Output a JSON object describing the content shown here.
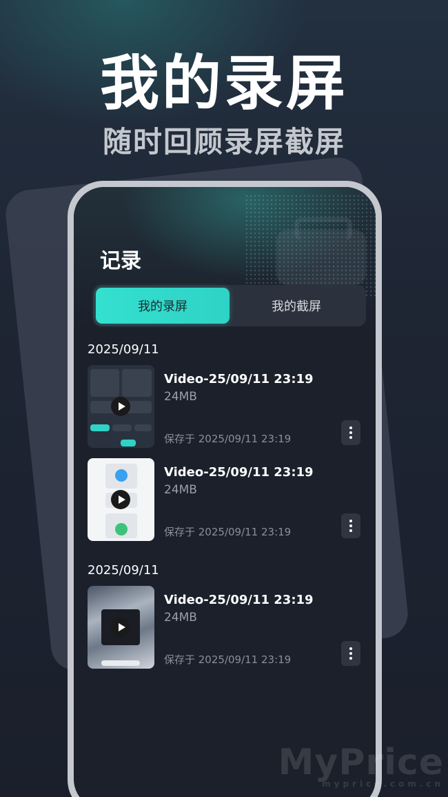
{
  "hero": {
    "title": "我的录屏",
    "subtitle": "随时回顾录屏截屏"
  },
  "screen": {
    "title": "记录",
    "tabs": [
      {
        "label": "我的录屏",
        "active": true
      },
      {
        "label": "我的截屏",
        "active": false
      }
    ],
    "groups": [
      {
        "date": "2025/09/11",
        "items": [
          {
            "name": "Video-25/09/11 23:19",
            "size": "24MB",
            "saved": "保存于 2025/09/11 23:19",
            "thumb": "dark-settings-screenshot"
          },
          {
            "name": "Video-25/09/11 23:19",
            "size": "24MB",
            "saved": "保存于 2025/09/11 23:19",
            "thumb": "light-app-screenshot"
          }
        ]
      },
      {
        "date": "2025/09/11",
        "items": [
          {
            "name": "Video-25/09/11 23:19",
            "size": "24MB",
            "saved": "保存于 2025/09/11 23:19",
            "thumb": "wallpaper-screenshot"
          }
        ]
      }
    ]
  },
  "watermark": {
    "brand": "MyPrice",
    "domain": "myprice.com.cn"
  },
  "colors": {
    "accent": "#34e0d0",
    "background": "#1c2230",
    "card": "#1b202b"
  }
}
